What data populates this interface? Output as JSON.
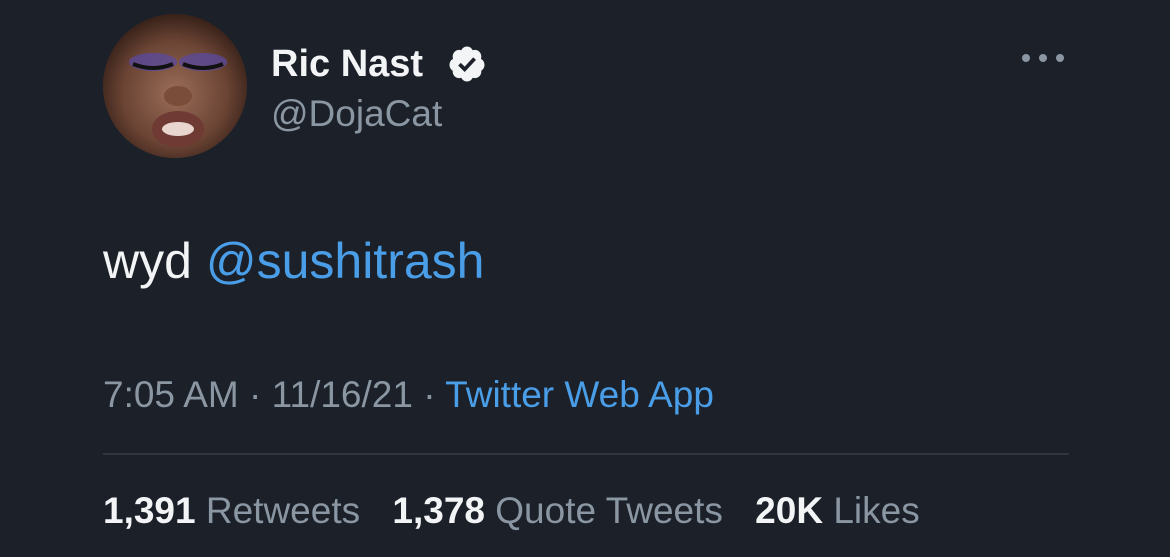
{
  "author": {
    "display_name": "Ric Nast",
    "handle": "@DojaCat",
    "verified": true,
    "verified_icon": "verified-badge-icon"
  },
  "menu": {
    "icon": "more-options-icon"
  },
  "tweet": {
    "text": "wyd",
    "mention": "@sushitrash"
  },
  "meta": {
    "time": "7:05 AM",
    "separator1": "·",
    "date": "11/16/21",
    "separator2": "·",
    "source": "Twitter Web App"
  },
  "stats": {
    "retweets_count": "1,391",
    "retweets_label": "Retweets",
    "quotes_count": "1,378",
    "quotes_label": "Quote Tweets",
    "likes_count": "20K",
    "likes_label": "Likes"
  },
  "colors": {
    "background": "#1b2029",
    "primary_text": "#f3f4f6",
    "secondary_text": "#8b96a3",
    "link": "#4a9ee8",
    "verified": "#f3f4f6"
  }
}
